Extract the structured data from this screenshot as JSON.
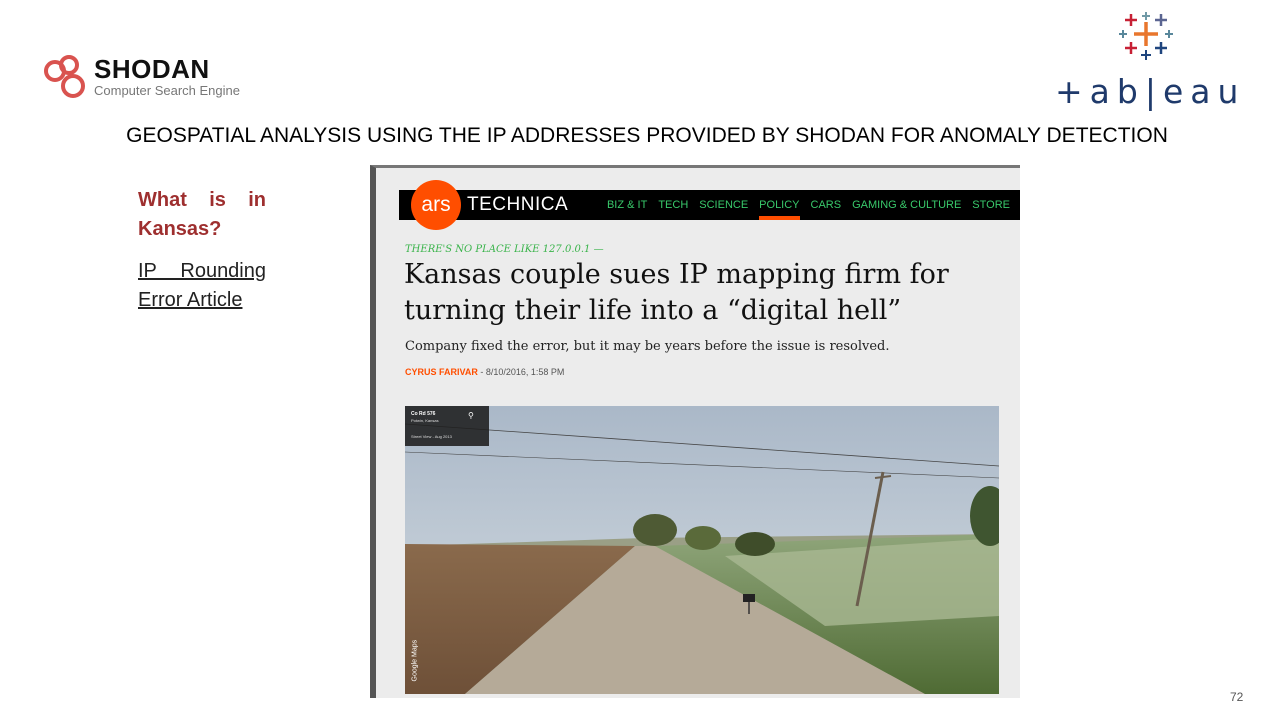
{
  "shodan": {
    "title": "SHODAN",
    "subtitle": "Computer Search Engine"
  },
  "tableau": {
    "wordmark": "+ab|eau"
  },
  "slide": {
    "title": "GEOSPATIAL ANALYSIS USING THE IP ADDRESSES PROVIDED BY SHODAN FOR ANOMALY DETECTION",
    "question": "What is in Kansas?",
    "link_text": "IP Rounding Error Article",
    "page_number": "72"
  },
  "article": {
    "logo_text": "ars",
    "site_name": "TECHNICA",
    "nav": [
      "BIZ & IT",
      "TECH",
      "SCIENCE",
      "POLICY",
      "CARS",
      "GAMING & CULTURE",
      "STORE"
    ],
    "active_nav": "POLICY",
    "kicker": "THERE'S NO PLACE LIKE 127.0.0.1 —",
    "headline": "Kansas couple sues IP mapping firm for turning their life into a “digital hell”",
    "dek": "Company fixed the error, but it may be years before the issue is resolved.",
    "author": "CYRUS FARIVAR",
    "date": " - 8/10/2016, 1:58 PM",
    "map_card": {
      "title": "Co Rd 576",
      "subtitle": "Potwin, Kansas",
      "meta": "Street View - Aug 2013"
    },
    "photo_credit": "Google Maps"
  },
  "colors": {
    "question": "#9e2f2f",
    "ars_orange": "#ff4e00",
    "ars_green": "#39c96b",
    "tableau_blue": "#1f3a6b"
  }
}
